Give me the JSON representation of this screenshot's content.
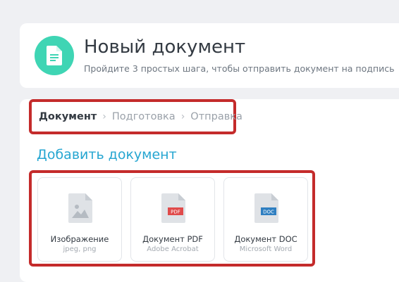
{
  "header": {
    "title": "Новый документ",
    "subtitle": "Пройдите 3 простых шага, чтобы отправить документ на подпись",
    "icon": "document-icon",
    "accent_color": "#3fd5b4"
  },
  "steps": [
    {
      "label": "Документ",
      "active": true
    },
    {
      "label": "Подготовка",
      "active": false
    },
    {
      "label": "Отправка",
      "active": false
    }
  ],
  "section": {
    "title": "Добавить документ",
    "title_color": "#26a6d1"
  },
  "options": [
    {
      "label": "Изображение",
      "sub": "jpeg, png",
      "icon": "image-file-icon"
    },
    {
      "label": "Документ PDF",
      "sub": "Adobe Acrobat",
      "icon": "pdf-file-icon",
      "badge": "PDF",
      "badge_color": "#e04b4b"
    },
    {
      "label": "Документ DOC",
      "sub": "Microsoft Word",
      "icon": "doc-file-icon",
      "badge": "DOC",
      "badge_color": "#2f7fc1"
    }
  ],
  "highlight_color": "#c42b2b"
}
